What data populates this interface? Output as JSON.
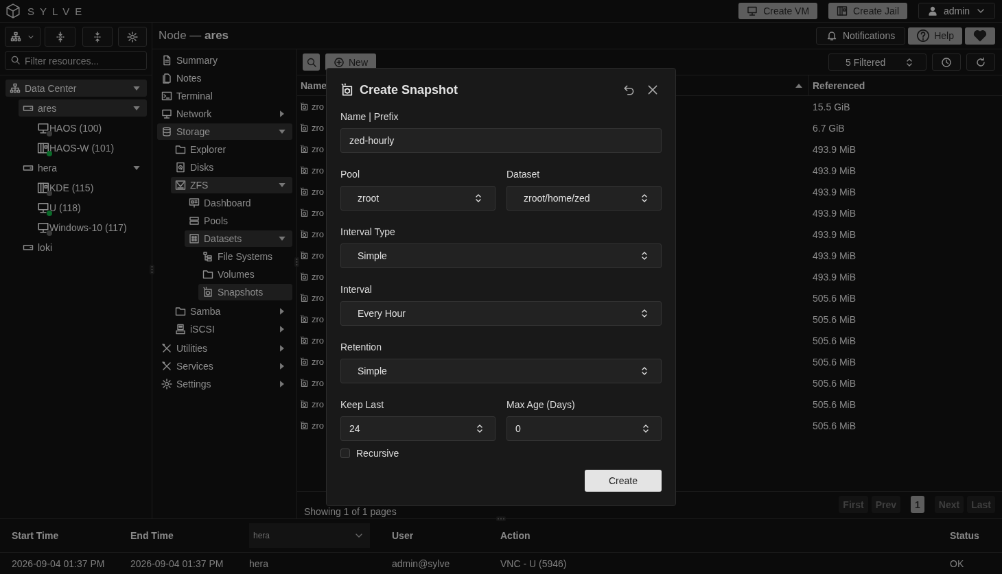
{
  "app": {
    "brand": "SYLVE",
    "actions": [
      {
        "label": "Create VM",
        "kind": "vm"
      },
      {
        "label": "Create Jail",
        "kind": "jail"
      }
    ],
    "user": "admin"
  },
  "sidebar": {
    "filter_placeholder": "Filter resources...",
    "tree": [
      {
        "label": "Data Center",
        "kind": "datacenter",
        "selected": true,
        "expanded": true,
        "children": [
          {
            "label": "ares",
            "kind": "node",
            "selected": true,
            "expanded": true,
            "children": [
              {
                "label": "HAOS (100)",
                "kind": "vm",
                "selected": false,
                "running": false
              },
              {
                "label": "HAOS-W (101)",
                "kind": "jail",
                "selected": false,
                "running": true
              }
            ]
          },
          {
            "label": "hera",
            "kind": "node",
            "selected": false,
            "expanded": true,
            "children": [
              {
                "label": "KDE (115)",
                "kind": "jail",
                "selected": false,
                "running": false
              },
              {
                "label": "U (118)",
                "kind": "vm",
                "selected": false,
                "running": true
              },
              {
                "label": "Windows-10 (117)",
                "kind": "vm",
                "selected": false,
                "running": false
              }
            ]
          },
          {
            "label": "loki",
            "kind": "node",
            "selected": false
          }
        ]
      }
    ]
  },
  "header": {
    "title": "Node — **ares**",
    "notifications": "Notifications",
    "help": "Help"
  },
  "nav": [
    {
      "label": "Summary",
      "selected": false
    },
    {
      "label": "Notes",
      "selected": false
    },
    {
      "label": "Terminal",
      "selected": false
    },
    {
      "label": "Network",
      "selected": false,
      "expanded": false
    },
    {
      "label": "Storage",
      "selected": true,
      "expanded": true,
      "children": [
        {
          "label": "Explorer",
          "selected": false
        },
        {
          "label": "Disks",
          "selected": false
        },
        {
          "label": "ZFS",
          "selected": true,
          "expanded": true,
          "children": [
            {
              "label": "Dashboard",
              "selected": false
            },
            {
              "label": "Pools",
              "selected": false
            },
            {
              "label": "Datasets",
              "selected": true,
              "expanded": true,
              "children": [
                {
                  "label": "File Systems",
                  "selected": false
                },
                {
                  "label": "Volumes",
                  "selected": false
                },
                {
                  "label": "Snapshots",
                  "selected": true
                }
              ]
            }
          ]
        },
        {
          "label": "Samba",
          "selected": false,
          "expanded": false
        },
        {
          "label": "iSCSI",
          "selected": false,
          "expanded": false
        }
      ]
    },
    {
      "label": "Utilities",
      "selected": false,
      "expanded": false
    },
    {
      "label": "Services",
      "selected": false,
      "expanded": false
    },
    {
      "label": "Settings",
      "selected": false,
      "expanded": false
    }
  ],
  "toolbar": {
    "new": "New",
    "filter": "5 Filtered"
  },
  "table": {
    "columns": [
      {
        "label": "Name"
      },
      {
        "ascending": true
      },
      {
        "label": "Referenced"
      }
    ],
    "rows": [
      {
        "name": "zro",
        "referenced": "15.5 GiB"
      },
      {
        "name": "zro",
        "referenced": "6.7 GiB"
      },
      {
        "name": "zro",
        "referenced": "493.9 MiB"
      },
      {
        "name": "zro",
        "referenced": "493.9 MiB"
      },
      {
        "name": "zro",
        "referenced": "493.9 MiB"
      },
      {
        "name": "zro",
        "referenced": "493.9 MiB"
      },
      {
        "name": "zro",
        "referenced": "493.9 MiB"
      },
      {
        "name": "zro",
        "referenced": "493.9 MiB"
      },
      {
        "name": "zro",
        "referenced": "493.9 MiB"
      },
      {
        "name": "zro",
        "referenced": "505.6 MiB"
      },
      {
        "name": "zro",
        "referenced": "505.6 MiB"
      },
      {
        "name": "zro",
        "referenced": "505.6 MiB"
      },
      {
        "name": "zro",
        "referenced": "505.6 MiB"
      },
      {
        "name": "zro",
        "referenced": "505.6 MiB"
      },
      {
        "name": "zro",
        "referenced": "505.6 MiB"
      },
      {
        "name": "zro",
        "referenced": "505.6 MiB"
      }
    ]
  },
  "pagination": {
    "summary": "Showing 1 of 1 pages",
    "buttons": [
      {
        "label": "First",
        "selected": false,
        "disabled": true
      },
      {
        "label": "Prev",
        "selected": false,
        "disabled": true
      },
      {
        "label": "1",
        "selected": true,
        "disabled": false
      },
      {
        "label": "Next",
        "selected": false,
        "disabled": true
      },
      {
        "label": "Last",
        "selected": false,
        "disabled": true
      }
    ]
  },
  "dialog": {
    "title": "Create Snapshot",
    "rows": [
      [
        {
          "label": "Name | Prefix",
          "kind": "text",
          "value": "zed-hourly"
        }
      ],
      [
        {
          "label": "Pool",
          "kind": "select",
          "value": "zroot"
        },
        {
          "label": "Dataset",
          "kind": "select",
          "value": "zroot/home/zed"
        }
      ],
      [
        {
          "label": "Interval Type",
          "kind": "select",
          "value": "Simple"
        }
      ],
      [
        {
          "label": "Interval",
          "kind": "select",
          "value": "Every Hour"
        }
      ],
      [
        {
          "label": "Retention",
          "kind": "select",
          "value": "Simple"
        }
      ],
      [
        {
          "label": "Keep Last",
          "kind": "number",
          "value": "24"
        },
        {
          "label": "Max Age (Days)",
          "kind": "number",
          "value": "0"
        }
      ]
    ],
    "recursive": {
      "label": "Recursive",
      "checked": false
    },
    "submit": "Create"
  },
  "audit": {
    "columns": [
      {
        "kind": "text",
        "label": "Start Time"
      },
      {
        "kind": "text",
        "label": "End Time"
      },
      {
        "kind": "select",
        "label": "hera"
      },
      {
        "kind": "text",
        "label": "User"
      },
      {
        "kind": "text",
        "label": "Action"
      },
      {
        "kind": "text",
        "label": "Status"
      }
    ],
    "rows": [
      [
        "2026-09-04 01:37 PM",
        "2026-09-04 01:37 PM",
        "hera",
        "admin@sylve",
        "VNC - U (5946)",
        "OK"
      ]
    ]
  }
}
